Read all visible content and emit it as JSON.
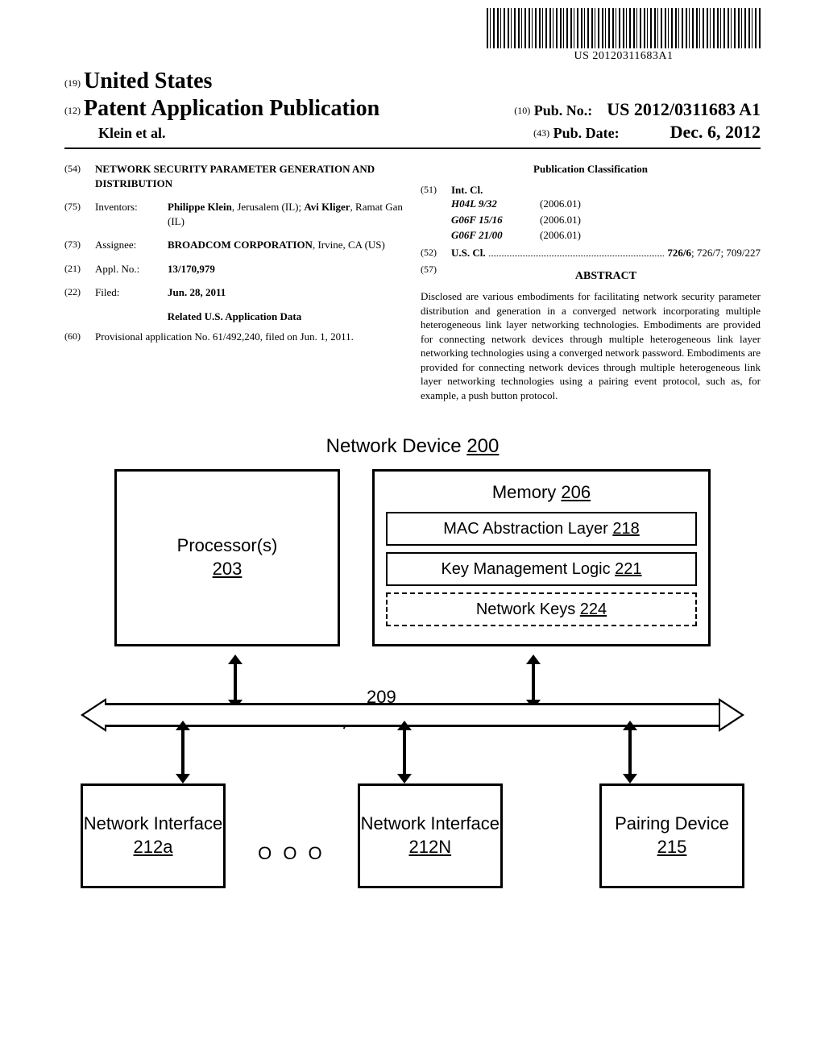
{
  "barcode_number": "US 20120311683A1",
  "header": {
    "num19": "(19)",
    "country": "United States",
    "num12": "(12)",
    "doc_type": "Patent Application Publication",
    "authors": "Klein et al.",
    "num10": "(10)",
    "pub_no_label": "Pub. No.:",
    "pub_no": "US 2012/0311683 A1",
    "num43": "(43)",
    "pub_date_label": "Pub. Date:",
    "pub_date": "Dec. 6, 2012"
  },
  "left": {
    "f54": {
      "num": "(54)",
      "title": "NETWORK SECURITY PARAMETER GENERATION AND DISTRIBUTION"
    },
    "f75": {
      "num": "(75)",
      "label": "Inventors:",
      "val_html": "Philippe Klein, Jerusalem (IL); Avi Kliger, Ramat Gan (IL)",
      "val_b1": "Philippe Klein",
      "val_t1": ", Jerusalem (IL); ",
      "val_b2": "Avi Kliger",
      "val_t2": ", Ramat Gan (IL)"
    },
    "f73": {
      "num": "(73)",
      "label": "Assignee:",
      "val_b": "BROADCOM CORPORATION",
      "val_t": ", Irvine, CA (US)"
    },
    "f21": {
      "num": "(21)",
      "label": "Appl. No.:",
      "val": "13/170,979"
    },
    "f22": {
      "num": "(22)",
      "label": "Filed:",
      "val": "Jun. 28, 2011"
    },
    "related_title": "Related U.S. Application Data",
    "f60": {
      "num": "(60)",
      "val": "Provisional application No. 61/492,240, filed on Jun. 1, 2011."
    }
  },
  "right": {
    "pub_class_title": "Publication Classification",
    "f51": {
      "num": "(51)",
      "label": "Int. Cl.",
      "rows": [
        {
          "code": "H04L 9/32",
          "year": "(2006.01)"
        },
        {
          "code": "G06F 15/16",
          "year": "(2006.01)"
        },
        {
          "code": "G06F 21/00",
          "year": "(2006.01)"
        }
      ]
    },
    "f52": {
      "num": "(52)",
      "label": "U.S. Cl.",
      "val": "726/6; 726/7; 709/227",
      "val_bold": "726/6"
    },
    "f57": {
      "num": "(57)",
      "title": "ABSTRACT"
    },
    "abstract": "Disclosed are various embodiments for facilitating network security parameter distribution and generation in a converged network incorporating multiple heterogeneous link layer networking technologies. Embodiments are provided for connecting network devices through multiple heterogeneous link layer networking technologies using a converged network password. Embodiments are provided for connecting network devices through multiple heterogeneous link layer networking technologies using a pairing event protocol, such as, for example, a push button protocol."
  },
  "figure": {
    "title_text": "Network Device ",
    "title_ref": "200",
    "processor": "Processor(s)",
    "processor_ref": "203",
    "memory": "Memory ",
    "memory_ref": "206",
    "mac": "MAC Abstraction Layer ",
    "mac_ref": "218",
    "kml": "Key Management Logic ",
    "kml_ref": "221",
    "nk": "Network Keys ",
    "nk_ref": "224",
    "bus_ref": "209",
    "ni": "Network Interface",
    "ni_a": "212a",
    "ni_n": "212N",
    "ooo": "O O O",
    "pd": "Pairing Device",
    "pd_ref": "215"
  }
}
